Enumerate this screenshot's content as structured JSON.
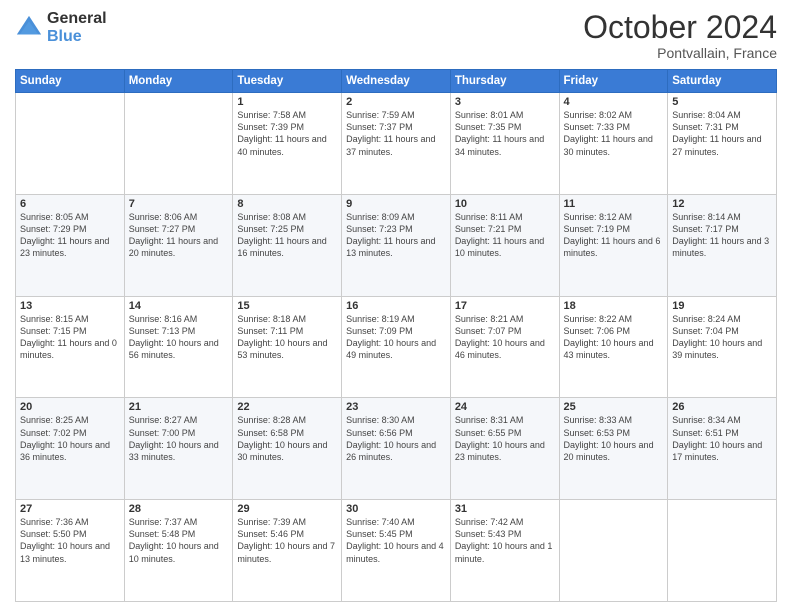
{
  "logo": {
    "line1": "General",
    "line2": "Blue"
  },
  "header": {
    "month": "October 2024",
    "location": "Pontvallain, France"
  },
  "weekdays": [
    "Sunday",
    "Monday",
    "Tuesday",
    "Wednesday",
    "Thursday",
    "Friday",
    "Saturday"
  ],
  "weeks": [
    [
      {
        "day": "",
        "sunrise": "",
        "sunset": "",
        "daylight": ""
      },
      {
        "day": "",
        "sunrise": "",
        "sunset": "",
        "daylight": ""
      },
      {
        "day": "1",
        "sunrise": "Sunrise: 7:58 AM",
        "sunset": "Sunset: 7:39 PM",
        "daylight": "Daylight: 11 hours and 40 minutes."
      },
      {
        "day": "2",
        "sunrise": "Sunrise: 7:59 AM",
        "sunset": "Sunset: 7:37 PM",
        "daylight": "Daylight: 11 hours and 37 minutes."
      },
      {
        "day": "3",
        "sunrise": "Sunrise: 8:01 AM",
        "sunset": "Sunset: 7:35 PM",
        "daylight": "Daylight: 11 hours and 34 minutes."
      },
      {
        "day": "4",
        "sunrise": "Sunrise: 8:02 AM",
        "sunset": "Sunset: 7:33 PM",
        "daylight": "Daylight: 11 hours and 30 minutes."
      },
      {
        "day": "5",
        "sunrise": "Sunrise: 8:04 AM",
        "sunset": "Sunset: 7:31 PM",
        "daylight": "Daylight: 11 hours and 27 minutes."
      }
    ],
    [
      {
        "day": "6",
        "sunrise": "Sunrise: 8:05 AM",
        "sunset": "Sunset: 7:29 PM",
        "daylight": "Daylight: 11 hours and 23 minutes."
      },
      {
        "day": "7",
        "sunrise": "Sunrise: 8:06 AM",
        "sunset": "Sunset: 7:27 PM",
        "daylight": "Daylight: 11 hours and 20 minutes."
      },
      {
        "day": "8",
        "sunrise": "Sunrise: 8:08 AM",
        "sunset": "Sunset: 7:25 PM",
        "daylight": "Daylight: 11 hours and 16 minutes."
      },
      {
        "day": "9",
        "sunrise": "Sunrise: 8:09 AM",
        "sunset": "Sunset: 7:23 PM",
        "daylight": "Daylight: 11 hours and 13 minutes."
      },
      {
        "day": "10",
        "sunrise": "Sunrise: 8:11 AM",
        "sunset": "Sunset: 7:21 PM",
        "daylight": "Daylight: 11 hours and 10 minutes."
      },
      {
        "day": "11",
        "sunrise": "Sunrise: 8:12 AM",
        "sunset": "Sunset: 7:19 PM",
        "daylight": "Daylight: 11 hours and 6 minutes."
      },
      {
        "day": "12",
        "sunrise": "Sunrise: 8:14 AM",
        "sunset": "Sunset: 7:17 PM",
        "daylight": "Daylight: 11 hours and 3 minutes."
      }
    ],
    [
      {
        "day": "13",
        "sunrise": "Sunrise: 8:15 AM",
        "sunset": "Sunset: 7:15 PM",
        "daylight": "Daylight: 11 hours and 0 minutes."
      },
      {
        "day": "14",
        "sunrise": "Sunrise: 8:16 AM",
        "sunset": "Sunset: 7:13 PM",
        "daylight": "Daylight: 10 hours and 56 minutes."
      },
      {
        "day": "15",
        "sunrise": "Sunrise: 8:18 AM",
        "sunset": "Sunset: 7:11 PM",
        "daylight": "Daylight: 10 hours and 53 minutes."
      },
      {
        "day": "16",
        "sunrise": "Sunrise: 8:19 AM",
        "sunset": "Sunset: 7:09 PM",
        "daylight": "Daylight: 10 hours and 49 minutes."
      },
      {
        "day": "17",
        "sunrise": "Sunrise: 8:21 AM",
        "sunset": "Sunset: 7:07 PM",
        "daylight": "Daylight: 10 hours and 46 minutes."
      },
      {
        "day": "18",
        "sunrise": "Sunrise: 8:22 AM",
        "sunset": "Sunset: 7:06 PM",
        "daylight": "Daylight: 10 hours and 43 minutes."
      },
      {
        "day": "19",
        "sunrise": "Sunrise: 8:24 AM",
        "sunset": "Sunset: 7:04 PM",
        "daylight": "Daylight: 10 hours and 39 minutes."
      }
    ],
    [
      {
        "day": "20",
        "sunrise": "Sunrise: 8:25 AM",
        "sunset": "Sunset: 7:02 PM",
        "daylight": "Daylight: 10 hours and 36 minutes."
      },
      {
        "day": "21",
        "sunrise": "Sunrise: 8:27 AM",
        "sunset": "Sunset: 7:00 PM",
        "daylight": "Daylight: 10 hours and 33 minutes."
      },
      {
        "day": "22",
        "sunrise": "Sunrise: 8:28 AM",
        "sunset": "Sunset: 6:58 PM",
        "daylight": "Daylight: 10 hours and 30 minutes."
      },
      {
        "day": "23",
        "sunrise": "Sunrise: 8:30 AM",
        "sunset": "Sunset: 6:56 PM",
        "daylight": "Daylight: 10 hours and 26 minutes."
      },
      {
        "day": "24",
        "sunrise": "Sunrise: 8:31 AM",
        "sunset": "Sunset: 6:55 PM",
        "daylight": "Daylight: 10 hours and 23 minutes."
      },
      {
        "day": "25",
        "sunrise": "Sunrise: 8:33 AM",
        "sunset": "Sunset: 6:53 PM",
        "daylight": "Daylight: 10 hours and 20 minutes."
      },
      {
        "day": "26",
        "sunrise": "Sunrise: 8:34 AM",
        "sunset": "Sunset: 6:51 PM",
        "daylight": "Daylight: 10 hours and 17 minutes."
      }
    ],
    [
      {
        "day": "27",
        "sunrise": "Sunrise: 7:36 AM",
        "sunset": "Sunset: 5:50 PM",
        "daylight": "Daylight: 10 hours and 13 minutes."
      },
      {
        "day": "28",
        "sunrise": "Sunrise: 7:37 AM",
        "sunset": "Sunset: 5:48 PM",
        "daylight": "Daylight: 10 hours and 10 minutes."
      },
      {
        "day": "29",
        "sunrise": "Sunrise: 7:39 AM",
        "sunset": "Sunset: 5:46 PM",
        "daylight": "Daylight: 10 hours and 7 minutes."
      },
      {
        "day": "30",
        "sunrise": "Sunrise: 7:40 AM",
        "sunset": "Sunset: 5:45 PM",
        "daylight": "Daylight: 10 hours and 4 minutes."
      },
      {
        "day": "31",
        "sunrise": "Sunrise: 7:42 AM",
        "sunset": "Sunset: 5:43 PM",
        "daylight": "Daylight: 10 hours and 1 minute."
      },
      {
        "day": "",
        "sunrise": "",
        "sunset": "",
        "daylight": ""
      },
      {
        "day": "",
        "sunrise": "",
        "sunset": "",
        "daylight": ""
      }
    ]
  ]
}
